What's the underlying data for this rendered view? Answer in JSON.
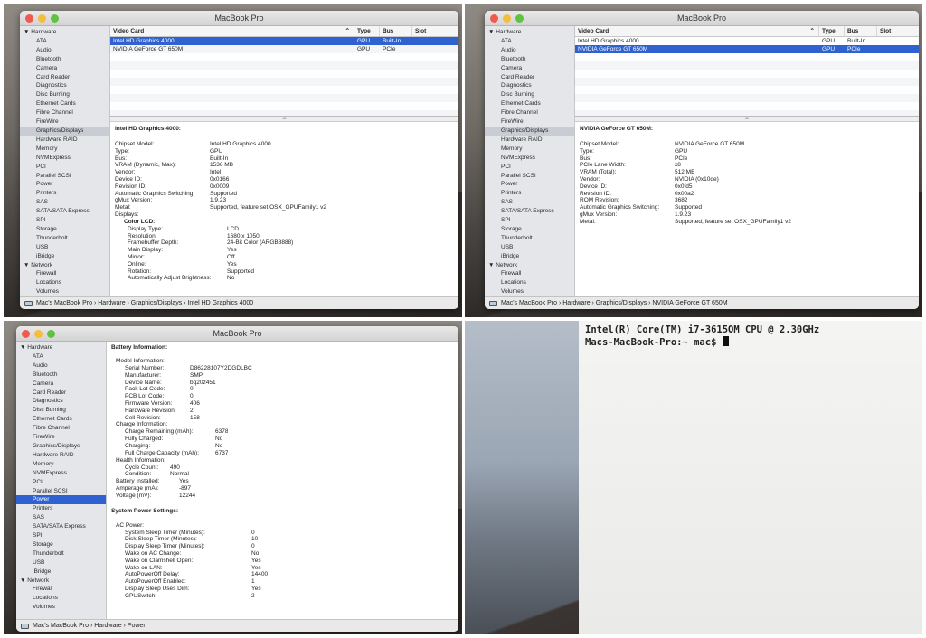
{
  "window_title": "MacBook Pro",
  "sidebar": {
    "hardware_label": "▼ Hardware",
    "hardware_items": [
      "ATA",
      "Audio",
      "Bluetooth",
      "Camera",
      "Card Reader",
      "Diagnostics",
      "Disc Burning",
      "Ethernet Cards",
      "Fibre Channel",
      "FireWire",
      "Graphics/Displays",
      "Hardware RAID",
      "Memory",
      "NVMExpress",
      "PCI",
      "Parallel SCSI",
      "Power",
      "Printers",
      "SAS",
      "SATA/SATA Express",
      "SPI",
      "Storage",
      "Thunderbolt",
      "USB",
      "iBridge"
    ],
    "network_label": "▼ Network",
    "network_items": [
      "Firewall",
      "Locations",
      "Volumes"
    ]
  },
  "graphics_table": {
    "headers": [
      "Video Card",
      "Type",
      "Bus",
      "Slot"
    ],
    "sort_indicator": "⌃",
    "rows": [
      [
        "Intel HD Graphics 4000",
        "GPU",
        "Built-In",
        ""
      ],
      [
        "NVIDIA GeForce GT 650M",
        "GPU",
        "PCIe",
        ""
      ]
    ]
  },
  "splitter_glyph": "═",
  "panel1": {
    "detail_title": "Intel HD Graphics 4000:",
    "fields": [
      [
        "Chipset Model:",
        "Intel HD Graphics 4000"
      ],
      [
        "Type:",
        "GPU"
      ],
      [
        "Bus:",
        "Built-In"
      ],
      [
        "VRAM (Dynamic, Max):",
        "1536 MB"
      ],
      [
        "Vendor:",
        "Intel"
      ],
      [
        "Device ID:",
        "0x0166"
      ],
      [
        "Revision ID:",
        "0x0009"
      ],
      [
        "Automatic Graphics Switching:",
        "Supported"
      ],
      [
        "gMux Version:",
        "1.9.23"
      ],
      [
        "Metal:",
        "Supported, feature set OSX_GPUFamily1 v2"
      ],
      [
        "Displays:",
        ""
      ]
    ],
    "display_heading": "Color LCD:",
    "display_fields": [
      [
        "Display Type:",
        "LCD"
      ],
      [
        "Resolution:",
        "1680 x 1050"
      ],
      [
        "Framebuffer Depth:",
        "24-Bit Color (ARGB8888)"
      ],
      [
        "Main Display:",
        "Yes"
      ],
      [
        "Mirror:",
        "Off"
      ],
      [
        "Online:",
        "Yes"
      ],
      [
        "Rotation:",
        "Supported"
      ],
      [
        "Automatically Adjust Brightness:",
        "No"
      ]
    ],
    "breadcrumb": "Mac's MacBook Pro  ›  Hardware  ›  Graphics/Displays  ›  Intel HD Graphics 4000"
  },
  "panel2": {
    "detail_title": "NVIDIA GeForce GT 650M:",
    "fields": [
      [
        "Chipset Model:",
        "NVIDIA GeForce GT 650M"
      ],
      [
        "Type:",
        "GPU"
      ],
      [
        "Bus:",
        "PCIe"
      ],
      [
        "PCIe Lane Width:",
        "x8"
      ],
      [
        "VRAM (Total):",
        "512 MB"
      ],
      [
        "Vendor:",
        "NVIDIA (0x10de)"
      ],
      [
        "Device ID:",
        "0x0fd5"
      ],
      [
        "Revision ID:",
        "0x00a2"
      ],
      [
        "ROM Revision:",
        "3682"
      ],
      [
        "Automatic Graphics Switching:",
        "Supported"
      ],
      [
        "gMux Version:",
        "1.9.23"
      ],
      [
        "Metal:",
        "Supported, feature set OSX_GPUFamily1 v2"
      ]
    ],
    "breadcrumb": "Mac's MacBook Pro  ›  Hardware  ›  Graphics/Displays  ›  NVIDIA GeForce GT 650M"
  },
  "panel3": {
    "battery_title": "Battery Information:",
    "model_heading": "Model Information:",
    "model_fields": [
      [
        "Serial Number:",
        "D86228107Y2DGDLBC"
      ],
      [
        "Manufacturer:",
        "SMP"
      ],
      [
        "Device Name:",
        "bq20z451"
      ],
      [
        "Pack Lot Code:",
        "0"
      ],
      [
        "PCB Lot Code:",
        "0"
      ],
      [
        "Firmware Version:",
        "406"
      ],
      [
        "Hardware Revision:",
        "2"
      ],
      [
        "Cell Revision:",
        "158"
      ]
    ],
    "charge_heading": "Charge Information:",
    "charge_fields": [
      [
        "Charge Remaining (mAh):",
        "6378"
      ],
      [
        "Fully Charged:",
        "No"
      ],
      [
        "Charging:",
        "No"
      ],
      [
        "Full Charge Capacity (mAh):",
        "6737"
      ]
    ],
    "health_heading": "Health Information:",
    "health_fields": [
      [
        "Cycle Count:",
        "490"
      ],
      [
        "Condition:",
        "Normal"
      ]
    ],
    "battery_fields": [
      [
        "Battery Installed:",
        "Yes"
      ],
      [
        "Amperage (mA):",
        "-897"
      ],
      [
        "Voltage (mV):",
        "12244"
      ]
    ],
    "power_title": "System Power Settings:",
    "ac_heading": "AC Power:",
    "ac_fields": [
      [
        "System Sleep Timer (Minutes):",
        "0"
      ],
      [
        "Disk Sleep Timer (Minutes):",
        "10"
      ],
      [
        "Display Sleep Timer (Minutes):",
        "0"
      ],
      [
        "Wake on AC Change:",
        "No"
      ],
      [
        "Wake on Clamshell Open:",
        "Yes"
      ],
      [
        "Wake on LAN:",
        "Yes"
      ],
      [
        "AutoPowerOff Delay:",
        "14400"
      ],
      [
        "AutoPowerOff Enabled:",
        "1"
      ],
      [
        "Display Sleep Uses Dim:",
        "Yes"
      ],
      [
        "GPUSwitch:",
        "2"
      ]
    ],
    "breadcrumb": "Mac's MacBook Pro  ›  Hardware  ›  Power"
  },
  "terminal": {
    "line1": "Intel(R) Core(TM) i7-3615QM CPU @ 2.30GHz",
    "prompt": "Macs-MacBook-Pro:~ mac$ "
  }
}
